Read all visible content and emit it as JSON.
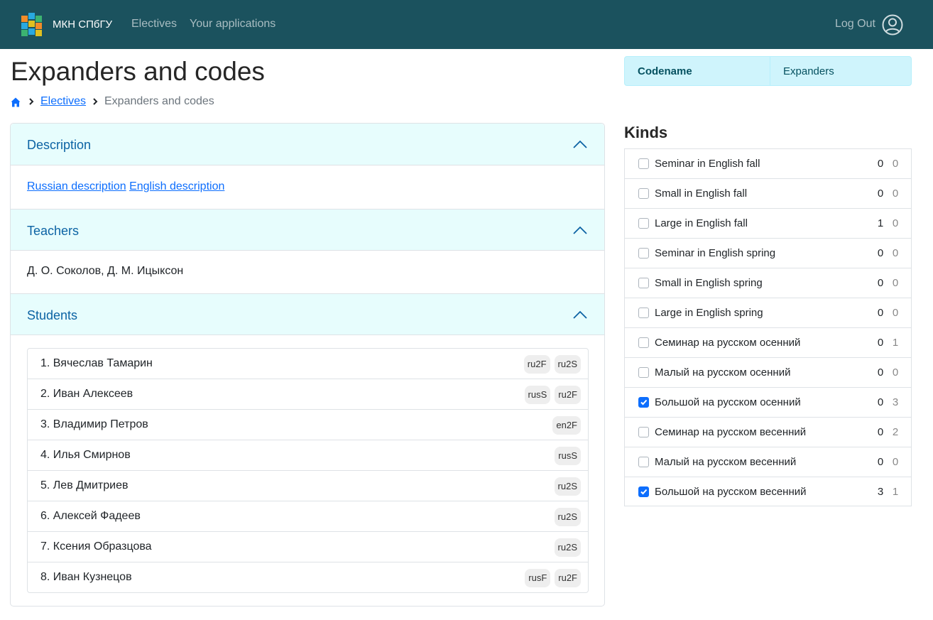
{
  "navbar": {
    "brand": "МКН СПбГУ",
    "links": [
      "Electives",
      "Your applications"
    ],
    "logout": "Log Out"
  },
  "page": {
    "title": "Expanders and codes"
  },
  "breadcrumb": {
    "link": "Electives",
    "current": "Expanders and codes"
  },
  "codename": {
    "label": "Codename",
    "value": "Expanders"
  },
  "accordion": {
    "description": {
      "title": "Description",
      "link_ru": "Russian description",
      "link_en": "English description"
    },
    "teachers": {
      "title": "Teachers",
      "text": "Д. О. Соколов, Д. М. Ицыксон"
    },
    "students": {
      "title": "Students",
      "list": [
        {
          "name": "1. Вячеслав Тамарин",
          "badges": [
            "ru2F",
            "ru2S"
          ]
        },
        {
          "name": "2. Иван Алексеев",
          "badges": [
            "rusS",
            "ru2F"
          ]
        },
        {
          "name": "3. Владимир Петров",
          "badges": [
            "en2F"
          ]
        },
        {
          "name": "4. Илья Смирнов",
          "badges": [
            "rusS"
          ]
        },
        {
          "name": "5. Лев Дмитриев",
          "badges": [
            "ru2S"
          ]
        },
        {
          "name": "6. Алексей Фадеев",
          "badges": [
            "ru2S"
          ]
        },
        {
          "name": "7. Ксения Образцова",
          "badges": [
            "ru2S"
          ]
        },
        {
          "name": "8. Иван Кузнецов",
          "badges": [
            "rusF",
            "ru2F"
          ]
        }
      ]
    }
  },
  "kinds": {
    "title": "Kinds",
    "items": [
      {
        "label": "Seminar in English fall",
        "a": "0",
        "b": "0",
        "checked": false
      },
      {
        "label": "Small in English fall",
        "a": "0",
        "b": "0",
        "checked": false
      },
      {
        "label": "Large in English fall",
        "a": "1",
        "b": "0",
        "checked": false
      },
      {
        "label": "Seminar in English spring",
        "a": "0",
        "b": "0",
        "checked": false
      },
      {
        "label": "Small in English spring",
        "a": "0",
        "b": "0",
        "checked": false
      },
      {
        "label": "Large in English spring",
        "a": "0",
        "b": "0",
        "checked": false
      },
      {
        "label": "Семинар на русском осенний",
        "a": "0",
        "b": "1",
        "checked": false
      },
      {
        "label": "Малый на русском осенний",
        "a": "0",
        "b": "0",
        "checked": false
      },
      {
        "label": "Большой на русском осенний",
        "a": "0",
        "b": "3",
        "checked": true
      },
      {
        "label": "Семинар на русском весенний",
        "a": "0",
        "b": "2",
        "checked": false
      },
      {
        "label": "Малый на русском весенний",
        "a": "0",
        "b": "0",
        "checked": false
      },
      {
        "label": "Большой на русском весенний",
        "a": "3",
        "b": "1",
        "checked": true
      }
    ]
  },
  "colors": {
    "navbar": "#1b525e",
    "accordion_header": "#e7fdfd",
    "link": "#0d6efd",
    "checkbox_checked": "#0d6efd"
  },
  "icons": {
    "logo": "cube-logo-icon",
    "user": "user-circle-icon",
    "home": "home-icon",
    "breadcrumb_separator": "chevron-right-icon",
    "accordion_toggle": "chevron-up-icon"
  }
}
